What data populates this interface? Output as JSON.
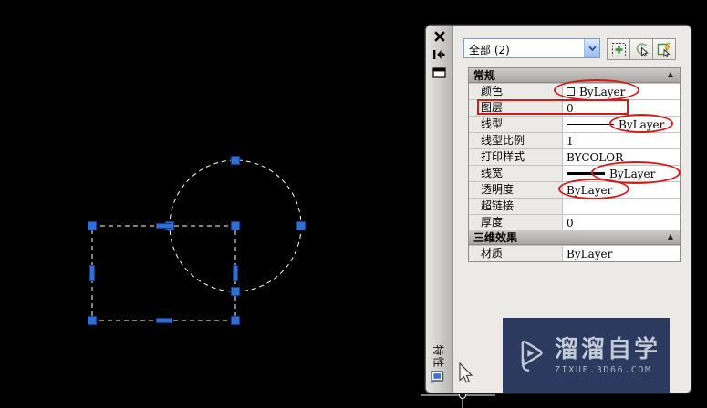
{
  "palette": {
    "title": "特性",
    "collapse_glyph": "▲",
    "selector": {
      "value": "全部 (2)"
    },
    "toolbar": {
      "buttons": [
        {
          "name": "toggle-pickadd"
        },
        {
          "name": "select-objects"
        },
        {
          "name": "quick-select"
        }
      ]
    },
    "sections": [
      {
        "title": "常规",
        "rows": [
          {
            "label": "颜色",
            "value": "ByLayer"
          },
          {
            "label": "图层",
            "value": "0"
          },
          {
            "label": "线型",
            "value": "ByLayer"
          },
          {
            "label": "线型比例",
            "value": "1"
          },
          {
            "label": "打印样式",
            "value": "BYCOLOR"
          },
          {
            "label": "线宽",
            "value": "ByLayer"
          },
          {
            "label": "透明度",
            "value": "ByLayer"
          },
          {
            "label": "超链接",
            "value": ""
          },
          {
            "label": "厚度",
            "value": "0"
          }
        ]
      },
      {
        "title": "三维效果",
        "rows": [
          {
            "label": "材质",
            "value": "ByLayer"
          }
        ]
      }
    ]
  },
  "annotations": {
    "color": "#cf1d1d",
    "highlighted_items": [
      "颜色",
      "图层",
      "线型",
      "线宽",
      "透明度"
    ]
  },
  "canvas": {
    "selection": {
      "objects_selected": 2,
      "shapes": [
        "circle",
        "rectangle"
      ]
    },
    "grip_color": "#2f6fd6",
    "dash_color": "#ffffff"
  },
  "watermark": {
    "brand": "溜溜自学",
    "site": "ZIXUE.3D66.COM",
    "background": "#2b3a5e"
  },
  "icons": {
    "close": "x-close",
    "auto_hide": "autohide-arrows",
    "palette_menu": "window-menu",
    "dropdown": "chevron-down",
    "pickadd": "dotted-square-green-plus",
    "select_objects": "cursor-with-arc",
    "quick_select": "rect-lightning-cursor",
    "palette_bottom": "monitor",
    "watermark_logo": "play-triangle"
  }
}
